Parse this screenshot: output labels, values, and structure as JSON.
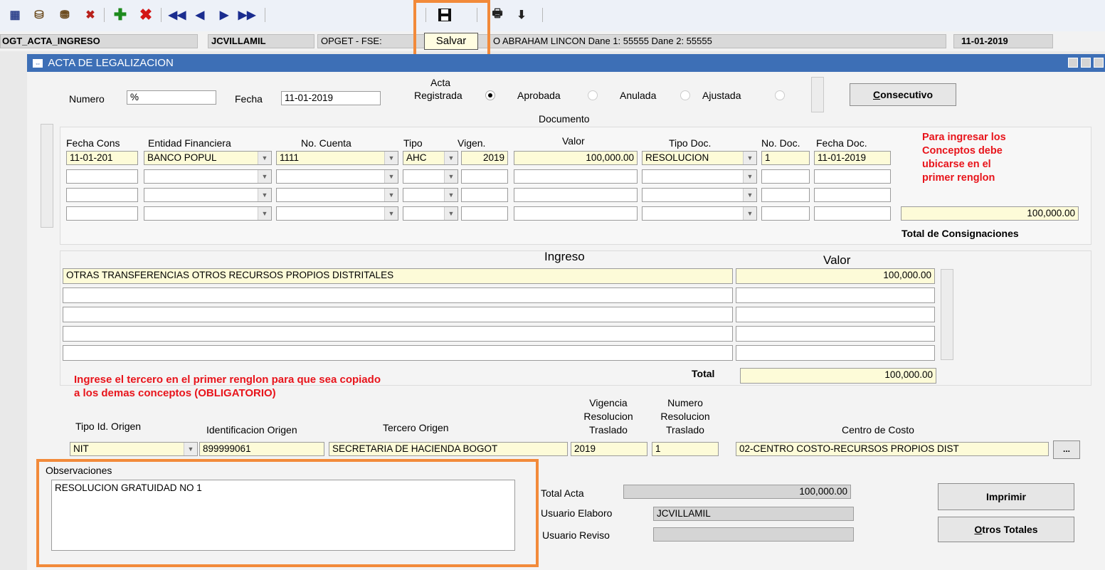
{
  "toolbar": {
    "icons": [
      "enter-query-icon",
      "execute-query-icon",
      "count-query-icon",
      "cancel-query-icon",
      "insert-record-icon",
      "delete-record-icon",
      "first-record-icon",
      "previous-record-icon",
      "next-record-icon",
      "last-record-icon",
      "save-icon",
      "print-icon",
      "download-icon"
    ],
    "tooltip": "Salvar"
  },
  "statusbar": {
    "form_name": "OGT_ACTA_INGRESO",
    "user": "JCVILLAMIL",
    "context": "OPGET - FSE: 1 ... LEGIO ABRAHAM LINCON Dane 1: 55555 Dane 2: 55555",
    "context_visible": "OPGET - FSE:",
    "context_rest": "O ABRAHAM LINCON Dane 1: 55555 Dane 2: 55555",
    "date": "11-01-2019"
  },
  "window": {
    "title": "ACTA DE LEGALIZACION"
  },
  "header": {
    "numero_label": "Numero",
    "numero_value": "%",
    "fecha_label": "Fecha",
    "fecha_value": "11-01-2019",
    "acta_label": "Acta",
    "estados": [
      "Registrada",
      "Aprobada",
      "Anulada",
      "Ajustada"
    ],
    "estado_selected": "Registrada",
    "consecutivo_button": "Consecutivo",
    "consecutivo_mnemonic": "C",
    "consecutivo_rest": "onsecutivo"
  },
  "documento": {
    "section_label": "Documento",
    "columns": [
      "Fecha Cons",
      "Entidad Financiera",
      "No. Cuenta",
      "Tipo",
      "Vigen.",
      "Valor",
      "Tipo Doc.",
      "No. Doc.",
      "Fecha Doc."
    ],
    "rows": [
      {
        "fecha_cons": "11-01-201",
        "entidad": "BANCO POPUL",
        "cuenta": "1111",
        "tipo": "AHC",
        "vigen": "2019",
        "valor": "100,000.00",
        "tipo_doc": "RESOLUCION",
        "no_doc": "1",
        "fecha_doc": "11-01-2019"
      }
    ],
    "note": [
      "Para ingresar los",
      "Conceptos debe",
      "ubicarse en el",
      "primer renglon"
    ],
    "total_value": "100,000.00",
    "total_label": "Total de Consignaciones"
  },
  "ingreso": {
    "col_ingreso": "Ingreso",
    "col_valor": "Valor",
    "rows": [
      {
        "ingreso": "OTRAS TRANSFERENCIAS OTROS RECURSOS PROPIOS DISTRITALES",
        "valor": "100,000.00"
      }
    ],
    "total_label": "Total",
    "total_value": "100,000.00"
  },
  "tercero": {
    "warning_line1": "Ingrese el tercero en el primer renglon para que sea copiado",
    "warning_line2": "a los demas conceptos (OBLIGATORIO)",
    "tipo_id_label": "Tipo Id. Origen",
    "identificacion_label": "Identificacion Origen",
    "tercero_label": "Tercero Origen",
    "vigencia_label": [
      "Vigencia",
      "Resolucion",
      "Traslado"
    ],
    "numero_label": [
      "Numero",
      "Resolucion",
      "Traslado"
    ],
    "centro_costo_label": "Centro de Costo",
    "tipo_id_value": "NIT",
    "identificacion_value": "899999061",
    "tercero_value": "SECRETARIA DE HACIENDA BOGOT",
    "vigencia_value": "2019",
    "numero_value": "1",
    "centro_costo_value": "02-CENTRO COSTO-RECURSOS PROPIOS DIST",
    "lov_button": "..."
  },
  "observaciones": {
    "label": "Observaciones",
    "value": "RESOLUCION GRATUIDAD NO 1"
  },
  "totales": {
    "total_acta_label": "Total Acta",
    "total_acta_value": "100,000.00",
    "usuario_elaboro_label": "Usuario Elaboro",
    "usuario_elaboro_value": "JCVILLAMIL",
    "usuario_reviso_label": "Usuario Reviso",
    "usuario_reviso_value": ""
  },
  "buttons": {
    "imprimir": "Imprimir",
    "otros_totales_mnemonic": "O",
    "otros_totales_rest": "tros Totales"
  },
  "colors": {
    "title_bar": "#3d6fb6",
    "highlight": "#f28a3a",
    "warning_text": "#e8141b",
    "field_yellow": "#fdfbd8"
  }
}
